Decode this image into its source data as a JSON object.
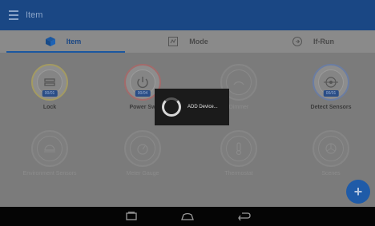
{
  "appbar": {
    "title": "Item",
    "menu_icon": "hamburger-menu-icon"
  },
  "tabs": [
    {
      "label": "Item",
      "icon": "cube-icon",
      "active": true
    },
    {
      "label": "Mode",
      "icon": "mode-icon",
      "active": false
    },
    {
      "label": "If-Run",
      "icon": "if-run-icon",
      "active": false
    }
  ],
  "items": [
    {
      "label": "Lock",
      "badge": "00/01",
      "icon": "lock-icon",
      "enabled": true,
      "ring": "yellow"
    },
    {
      "label": "Power Sw",
      "badge": "00/04",
      "icon": "power-icon",
      "enabled": true,
      "ring": "red"
    },
    {
      "label": "Dimmer",
      "badge": "",
      "icon": "dimmer-icon",
      "enabled": false,
      "ring": ""
    },
    {
      "label": "Detect Sensors",
      "badge": "00/01",
      "icon": "sensor-icon",
      "enabled": true,
      "ring": "blue"
    },
    {
      "label": "Environment Sensors",
      "badge": "",
      "icon": "environment-icon",
      "enabled": false,
      "ring": ""
    },
    {
      "label": "Meter Gauge",
      "badge": "",
      "icon": "gauge-icon",
      "enabled": false,
      "ring": ""
    },
    {
      "label": "Thermostat",
      "badge": "",
      "icon": "thermostat-icon",
      "enabled": false,
      "ring": ""
    },
    {
      "label": "Scenes",
      "badge": "",
      "icon": "scenes-icon",
      "enabled": false,
      "ring": ""
    }
  ],
  "fab": {
    "label": "+"
  },
  "dialog": {
    "message": "ADD Device..."
  },
  "navbar": {
    "buttons": [
      "recent-apps-icon",
      "home-icon",
      "back-icon"
    ]
  },
  "colors": {
    "appbar": "#1a4784",
    "accent": "#1f5ba8",
    "navbar": "#050505"
  }
}
